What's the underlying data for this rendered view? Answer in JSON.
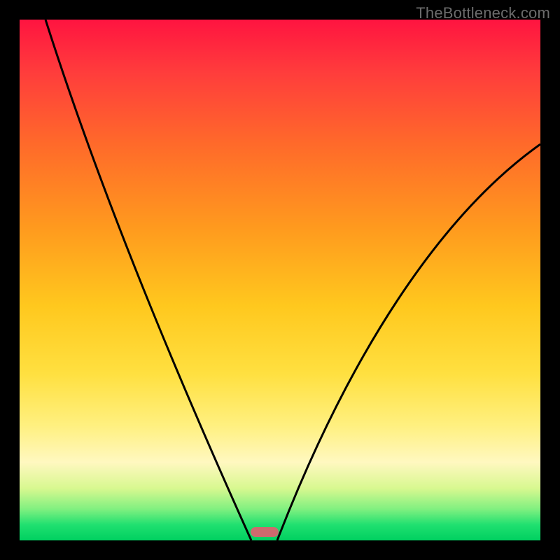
{
  "watermark": "TheBottleneck.com",
  "chart_data": {
    "type": "line",
    "title": "",
    "xlabel": "",
    "ylabel": "",
    "xlim": [
      0,
      100
    ],
    "ylim": [
      0,
      100
    ],
    "grid": false,
    "annotations": [],
    "marker": {
      "x_center": 47,
      "width_pct": 5,
      "y": 0,
      "color": "#cd6a6e"
    },
    "series": [
      {
        "name": "left-curve",
        "color": "#000000",
        "x": [
          5,
          10,
          15,
          20,
          25,
          30,
          35,
          40,
          44.5
        ],
        "values": [
          100,
          84,
          69,
          55,
          43,
          32,
          22,
          12,
          0
        ]
      },
      {
        "name": "right-curve",
        "color": "#000000",
        "x": [
          49.5,
          55,
          60,
          65,
          70,
          75,
          80,
          85,
          90,
          95,
          100
        ],
        "values": [
          0,
          14,
          25,
          35,
          43,
          51,
          57,
          63,
          68,
          72,
          76
        ]
      }
    ],
    "background_gradient": {
      "direction": "vertical",
      "stops": [
        {
          "pos": 0,
          "color": "#ff1440"
        },
        {
          "pos": 10,
          "color": "#ff3c3c"
        },
        {
          "pos": 24,
          "color": "#ff6a2a"
        },
        {
          "pos": 40,
          "color": "#ff9a1e"
        },
        {
          "pos": 55,
          "color": "#ffc81e"
        },
        {
          "pos": 68,
          "color": "#ffe040"
        },
        {
          "pos": 78,
          "color": "#fff080"
        },
        {
          "pos": 85,
          "color": "#fff8c0"
        },
        {
          "pos": 90,
          "color": "#d8f890"
        },
        {
          "pos": 94,
          "color": "#80f080"
        },
        {
          "pos": 97,
          "color": "#20e070"
        },
        {
          "pos": 100,
          "color": "#00d060"
        }
      ]
    }
  }
}
